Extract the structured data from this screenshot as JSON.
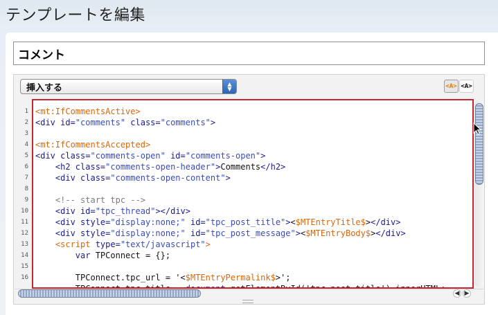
{
  "page": {
    "title": "テンプレートを編集"
  },
  "template_name": {
    "value": "コメント"
  },
  "toolbar": {
    "insert_label": "挿入する",
    "mode_highlight": "<A>",
    "mode_plain": "<A>"
  },
  "editor": {
    "line_numbers": [
      "1",
      "2",
      "3",
      "4",
      "5",
      "6",
      "7",
      "8",
      "9",
      "10",
      "11",
      "12",
      "13",
      "14",
      "15",
      "16"
    ],
    "lines": [
      [
        [
          "mt",
          "<mt:IfCommentsActive>"
        ]
      ],
      [
        [
          "tag",
          "<div "
        ],
        [
          "attr",
          "id="
        ],
        [
          "val",
          "\"comments\""
        ],
        [
          "attr",
          " class="
        ],
        [
          "val",
          "\"comments\""
        ],
        [
          "tag",
          ">"
        ]
      ],
      [],
      [
        [
          "mt",
          "<mt:IfCommentsAccepted>"
        ]
      ],
      [
        [
          "tag",
          "<div "
        ],
        [
          "attr",
          "class="
        ],
        [
          "val",
          "\"comments-open\""
        ],
        [
          "attr",
          " id="
        ],
        [
          "val",
          "\"comments-open\""
        ],
        [
          "tag",
          ">"
        ]
      ],
      [
        [
          "tag",
          "    <h2 "
        ],
        [
          "attr",
          "class="
        ],
        [
          "val",
          "\"comments-open-header\""
        ],
        [
          "tag",
          ">"
        ],
        [
          "txt",
          "Comments"
        ],
        [
          "tag",
          "</h2>"
        ]
      ],
      [
        [
          "tag",
          "    <div "
        ],
        [
          "attr",
          "class="
        ],
        [
          "val",
          "\"comments-open-content\""
        ],
        [
          "tag",
          ">"
        ]
      ],
      [],
      [
        [
          "cmt",
          "    <!-- start tpc -->"
        ]
      ],
      [
        [
          "tag",
          "    <div "
        ],
        [
          "attr",
          "id="
        ],
        [
          "val",
          "\"tpc_thread\""
        ],
        [
          "tag",
          "></div>"
        ]
      ],
      [
        [
          "tag",
          "    <div "
        ],
        [
          "attr",
          "style="
        ],
        [
          "val",
          "\"display:none;\""
        ],
        [
          "attr",
          " id="
        ],
        [
          "val",
          "\"tpc_post_title\""
        ],
        [
          "tag",
          ">"
        ],
        [
          "txt",
          "<"
        ],
        [
          "mtv",
          "$MTEntryTitle$"
        ],
        [
          "txt",
          ">"
        ],
        [
          "tag",
          "</div>"
        ]
      ],
      [
        [
          "tag",
          "    <div "
        ],
        [
          "attr",
          "style="
        ],
        [
          "val",
          "\"display:none;\""
        ],
        [
          "attr",
          " id="
        ],
        [
          "val",
          "\"tpc_post_message\""
        ],
        [
          "tag",
          ">"
        ],
        [
          "txt",
          "<"
        ],
        [
          "mtv",
          "$MTEntryBody$"
        ],
        [
          "txt",
          ">"
        ],
        [
          "tag",
          "</div>"
        ]
      ],
      [
        [
          "mt",
          "    <script "
        ],
        [
          "attr",
          "type="
        ],
        [
          "val",
          "\"text/javascript\""
        ],
        [
          "mt",
          ">"
        ]
      ],
      [
        [
          "kw",
          "        var "
        ],
        [
          "txt",
          "TPConnect = {};"
        ]
      ],
      [],
      [
        [
          "txt",
          "        TPConnect.tpc_url = '<"
        ],
        [
          "mtv",
          "$MTEntryPermalink$"
        ],
        [
          "txt",
          ">';"
        ]
      ],
      [
        [
          "txt",
          "        TPConnect.tpc_title = "
        ],
        [
          "kw",
          "document"
        ],
        [
          "txt",
          ".getElementById('tpc_post_title').innerHTML;"
        ]
      ]
    ]
  },
  "colors": {
    "editor_border": "#c8262c",
    "mt_tag": "#d9650a",
    "html_tag": "#1a1a8c",
    "attr_value": "#3a4bb8",
    "comment": "#7a7a7a"
  },
  "icons": {
    "select_arrows": "updown-arrows-icon",
    "scroll_left": "left-arrow-icon",
    "scroll_right": "right-arrow-icon",
    "cursor": "mouse-pointer-icon"
  }
}
